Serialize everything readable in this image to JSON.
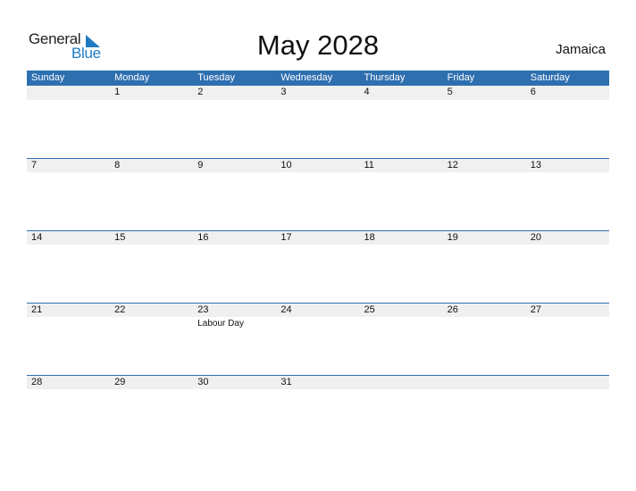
{
  "logo": {
    "word1": "General",
    "word2": "Blue"
  },
  "header": {
    "title": "May 2028",
    "country": "Jamaica"
  },
  "colors": {
    "accent": "#2e6fb0",
    "strip": "#f0f0f0",
    "logo_blue": "#1f7ac2"
  },
  "weekdays": [
    "Sunday",
    "Monday",
    "Tuesday",
    "Wednesday",
    "Thursday",
    "Friday",
    "Saturday"
  ],
  "weeks": [
    {
      "days": [
        "",
        "1",
        "2",
        "3",
        "4",
        "5",
        "6"
      ],
      "events": [
        "",
        "",
        "",
        "",
        "",
        "",
        ""
      ]
    },
    {
      "days": [
        "7",
        "8",
        "9",
        "10",
        "11",
        "12",
        "13"
      ],
      "events": [
        "",
        "",
        "",
        "",
        "",
        "",
        ""
      ]
    },
    {
      "days": [
        "14",
        "15",
        "16",
        "17",
        "18",
        "19",
        "20"
      ],
      "events": [
        "",
        "",
        "",
        "",
        "",
        "",
        ""
      ]
    },
    {
      "days": [
        "21",
        "22",
        "23",
        "24",
        "25",
        "26",
        "27"
      ],
      "events": [
        "",
        "",
        "Labour Day",
        "",
        "",
        "",
        ""
      ]
    },
    {
      "days": [
        "28",
        "29",
        "30",
        "31",
        "",
        "",
        ""
      ],
      "events": [
        "",
        "",
        "",
        "",
        "",
        "",
        ""
      ]
    }
  ]
}
